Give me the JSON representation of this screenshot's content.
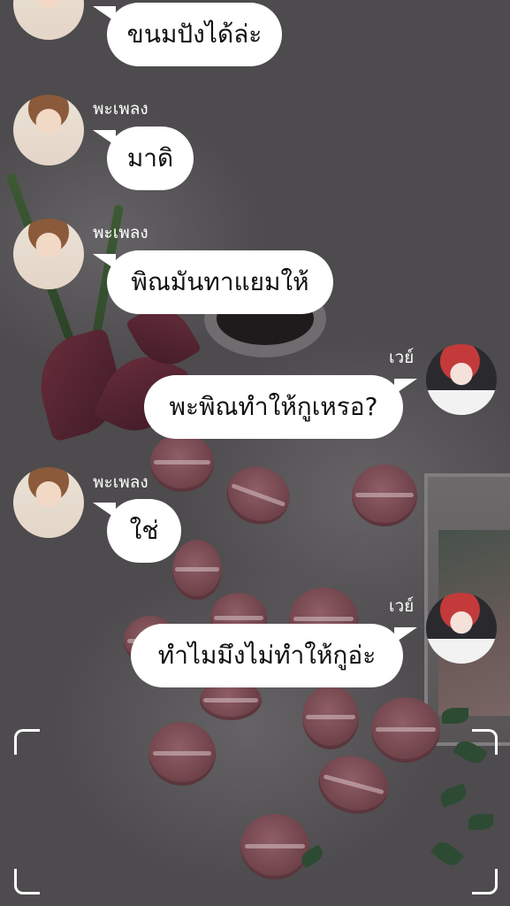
{
  "messages": [
    {
      "side": "left",
      "avatar": "jin-avatar",
      "sender": "",
      "text": "ขนมปังได้ล่ะ"
    },
    {
      "side": "left",
      "avatar": "jin-avatar",
      "sender": "พะเพลง",
      "text": "มาดิ"
    },
    {
      "side": "left",
      "avatar": "jin-avatar",
      "sender": "พะเพลง",
      "text": "พิณมันทาแยมให้"
    },
    {
      "side": "right",
      "avatar": "wei-avatar",
      "sender": "เวย์",
      "text": "พะพิณทำให้กูเหรอ?"
    },
    {
      "side": "left",
      "avatar": "jin-avatar",
      "sender": "พะเพลง",
      "text": "ใช่"
    },
    {
      "side": "right",
      "avatar": "wei-avatar",
      "sender": "เวย์",
      "text": "ทำไมมึงไม่ทำให้กูอ่ะ"
    }
  ],
  "colors": {
    "bubble": "#ffffff",
    "text": "#111111",
    "sender": "#ffffff",
    "background": "#4d4b4d"
  }
}
